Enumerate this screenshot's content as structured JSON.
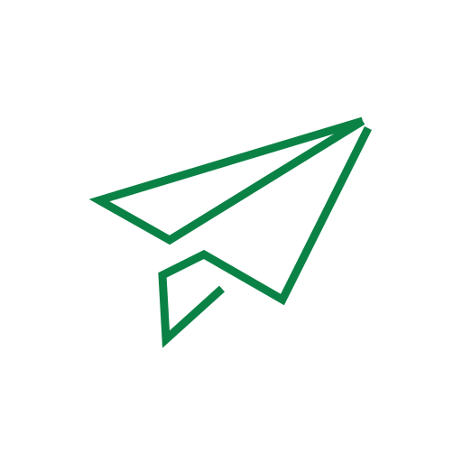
{
  "icon": {
    "name": "paper-plane-icon",
    "color": "#0b8245",
    "background": "#ffffff"
  }
}
